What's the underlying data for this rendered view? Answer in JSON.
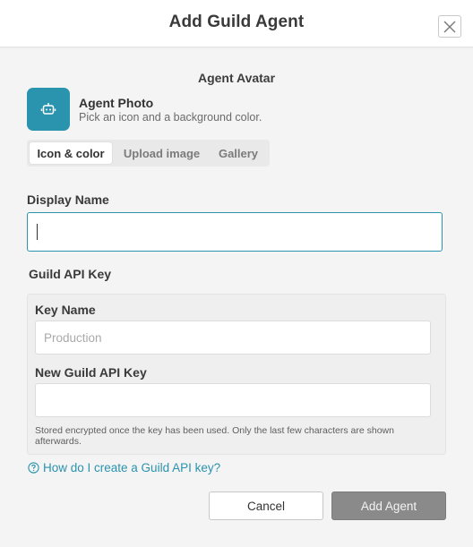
{
  "header": {
    "title": "Add Guild Agent",
    "close_icon": "close-icon"
  },
  "avatar": {
    "section_heading": "Agent Avatar",
    "icon": "robot-icon",
    "tile_color": "#2a93ad",
    "title": "Agent Photo",
    "subtitle": "Pick an icon and a background color.",
    "tabs": [
      {
        "label": "Icon & color",
        "active": true
      },
      {
        "label": "Upload image",
        "active": false
      },
      {
        "label": "Gallery",
        "active": false
      }
    ]
  },
  "display_name": {
    "label": "Display Name",
    "value": "",
    "placeholder": ""
  },
  "api_key": {
    "section_label": "Guild API Key",
    "key_name": {
      "label": "Key Name",
      "value": "",
      "placeholder": "Production"
    },
    "new_key": {
      "label": "New Guild API Key",
      "value": "",
      "placeholder": ""
    },
    "note": "Stored encrypted once the key has been used. Only the last few characters are shown afterwards."
  },
  "help": {
    "icon": "question-circle-icon",
    "text": "How do I create a Guild API key?"
  },
  "footer": {
    "cancel_label": "Cancel",
    "submit_label": "Add Agent"
  },
  "colors": {
    "accent": "#2a93ad",
    "disabled_button": "#8a8a8a"
  }
}
